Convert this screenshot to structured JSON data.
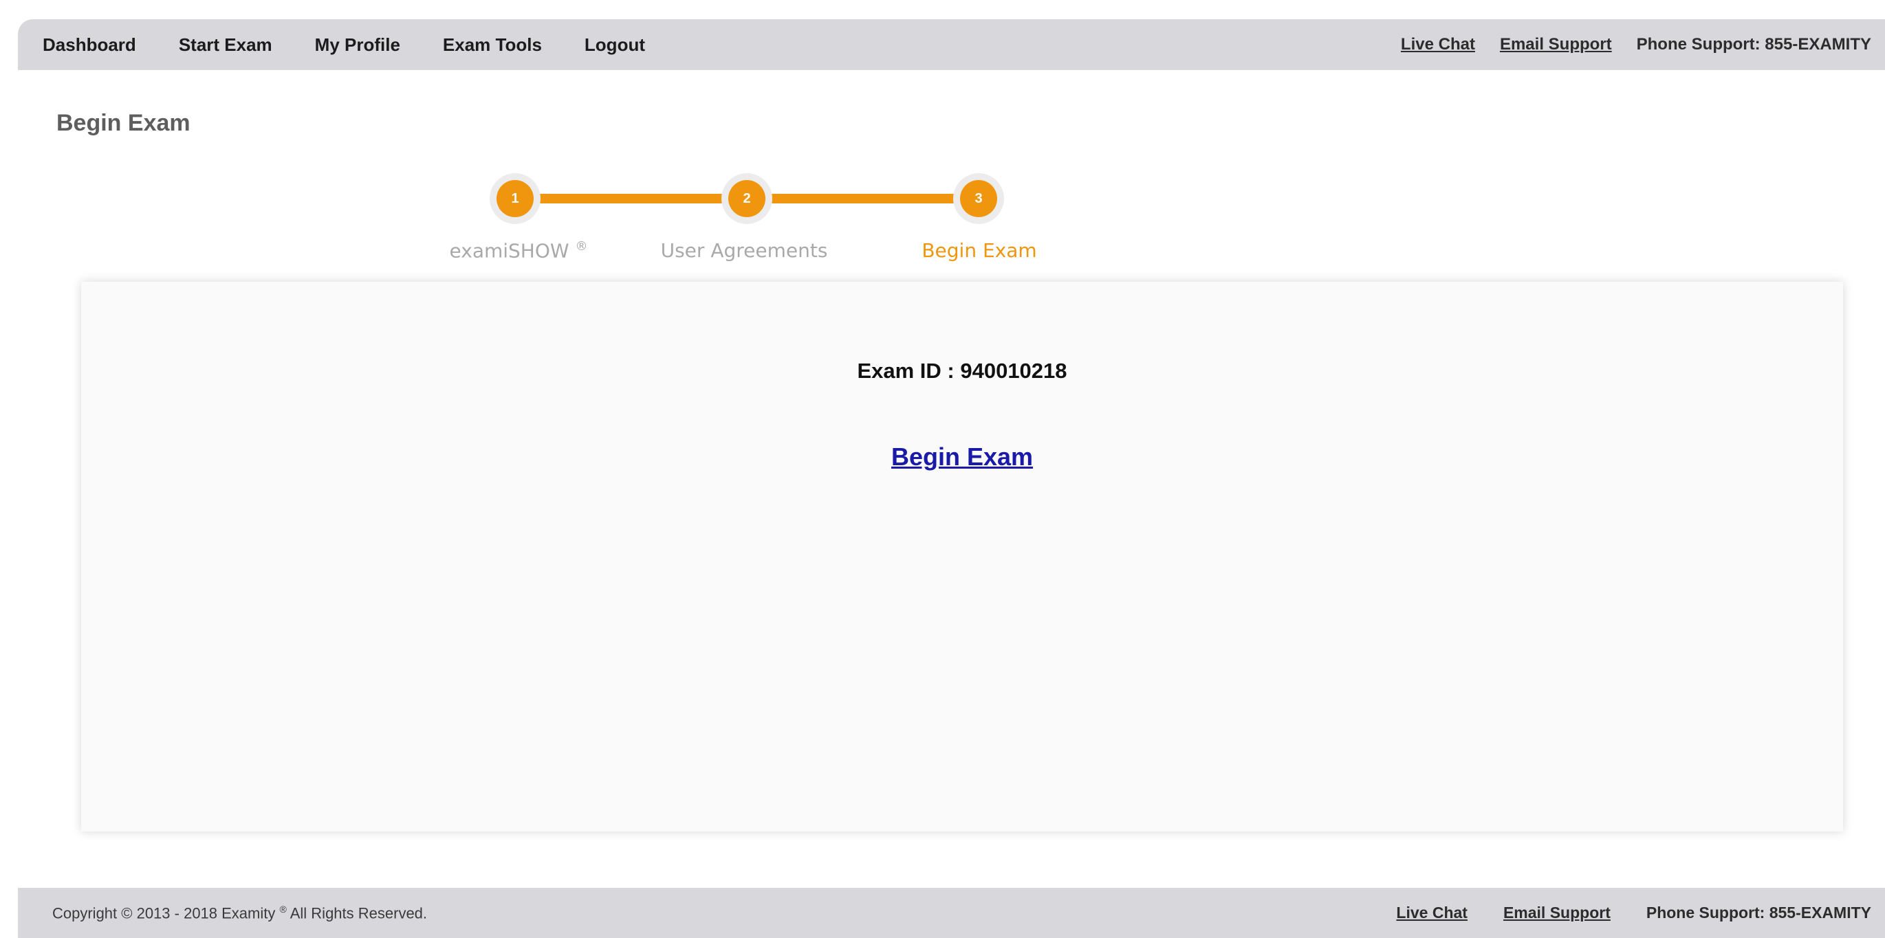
{
  "nav": {
    "items": [
      {
        "label": "Dashboard"
      },
      {
        "label": "Start Exam"
      },
      {
        "label": "My Profile"
      },
      {
        "label": "Exam Tools"
      },
      {
        "label": "Logout"
      }
    ],
    "live_chat": "Live Chat",
    "email_support": "Email Support",
    "phone_support": "Phone Support: 855-EXAMITY"
  },
  "page": {
    "title": "Begin Exam"
  },
  "stepper": {
    "steps": [
      {
        "number": "1",
        "label": "examiSHOW",
        "mark": "®"
      },
      {
        "number": "2",
        "label": "User Agreements"
      },
      {
        "number": "3",
        "label": "Begin Exam"
      }
    ],
    "accent_color": "#f0960e"
  },
  "card": {
    "exam_id_label": "Exam ID : 940010218",
    "begin_link": "Begin Exam"
  },
  "footer": {
    "copyright": "Copyright © 2013 - 2018 Examity",
    "copyright_mark": "®",
    "rights": "All Rights Reserved.",
    "live_chat": "Live Chat",
    "email_support": "Email Support",
    "phone_support": "Phone Support: 855-EXAMITY"
  }
}
